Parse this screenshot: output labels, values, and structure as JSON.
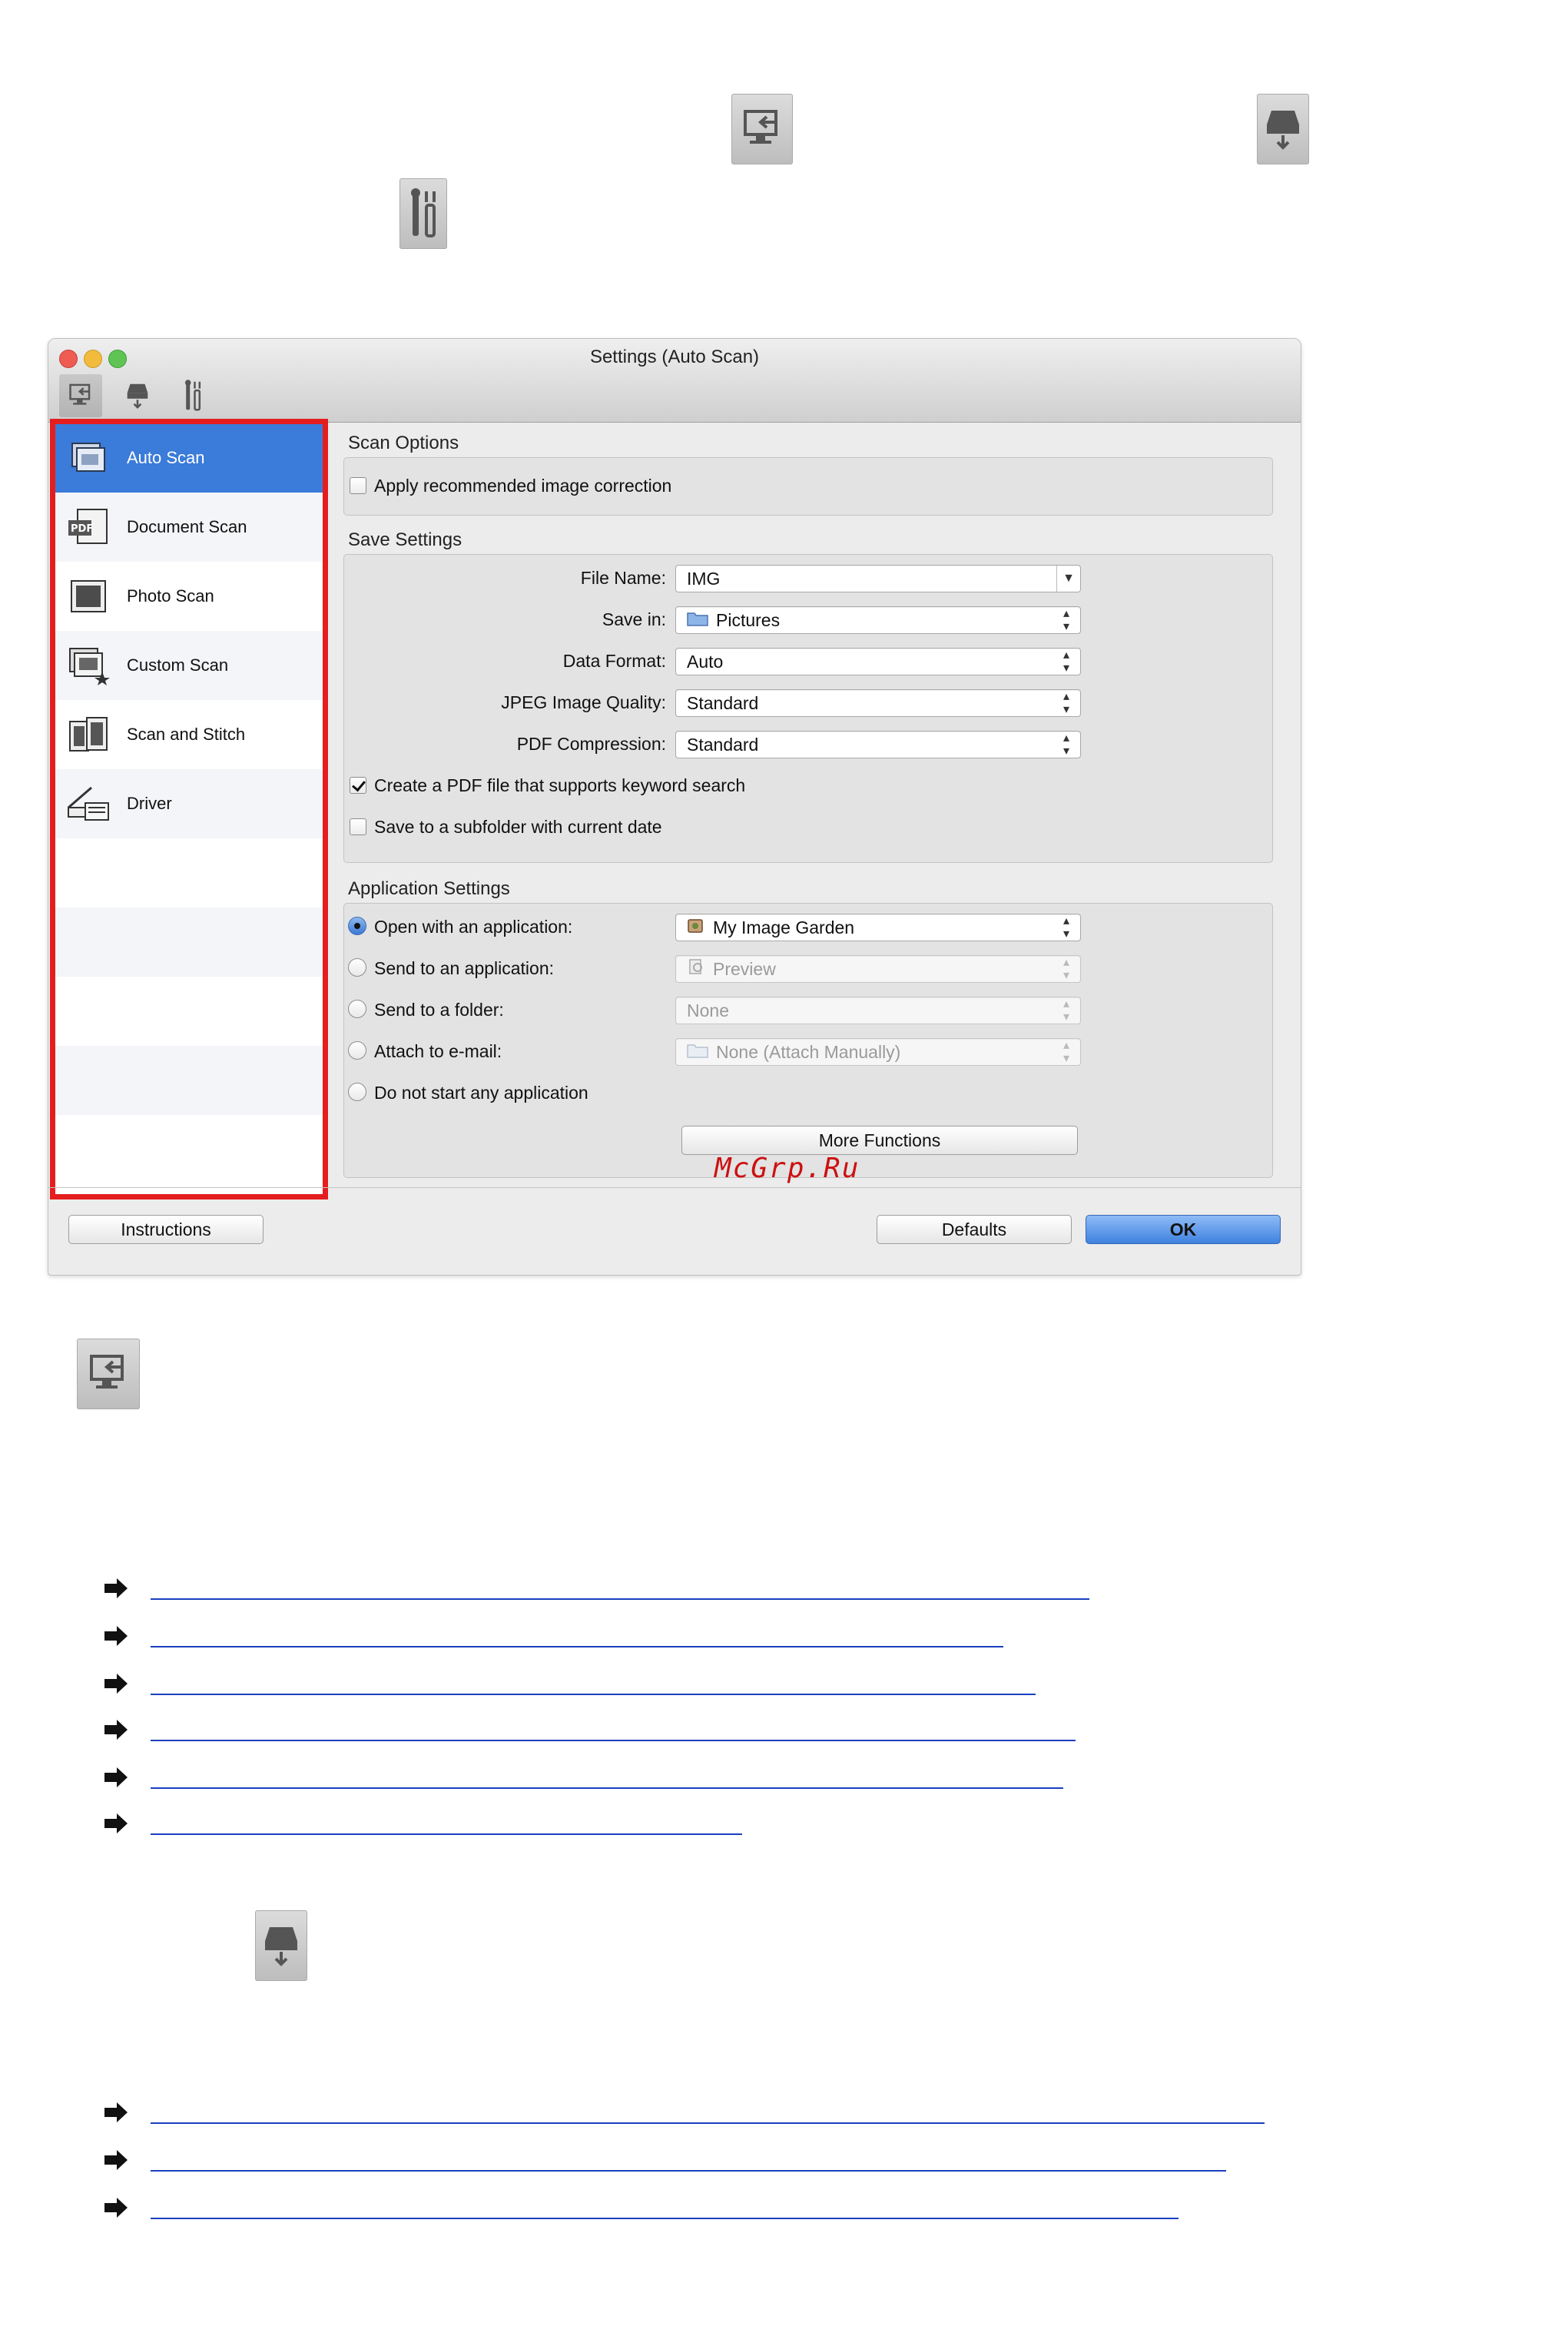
{
  "window": {
    "title": "Settings (Auto Scan)",
    "toolbar_tabs": [
      {
        "name": "scanning-from-computer-tab",
        "icon": "computer-scan-icon"
      },
      {
        "name": "scanning-from-operation-panel-tab",
        "icon": "scanner-icon"
      },
      {
        "name": "general-settings-tab",
        "icon": "tools-icon"
      }
    ]
  },
  "sidebar": {
    "items": [
      {
        "label": "Auto Scan",
        "icon": "auto-scan-icon",
        "selected": true
      },
      {
        "label": "Document Scan",
        "icon": "pdf-document-icon",
        "selected": false
      },
      {
        "label": "Photo Scan",
        "icon": "photo-icon",
        "selected": false
      },
      {
        "label": "Custom Scan",
        "icon": "custom-scan-icon",
        "selected": false
      },
      {
        "label": "Scan and Stitch",
        "icon": "stitch-icon",
        "selected": false
      },
      {
        "label": "Driver",
        "icon": "driver-icon",
        "selected": false
      }
    ]
  },
  "scan_options": {
    "title": "Scan Options",
    "apply_correction": {
      "label": "Apply recommended image correction",
      "checked": false
    }
  },
  "save_settings": {
    "title": "Save Settings",
    "file_name": {
      "label": "File Name:",
      "value": "IMG"
    },
    "save_in": {
      "label": "Save in:",
      "value": "Pictures",
      "icon": "folder-icon"
    },
    "data_format": {
      "label": "Data Format:",
      "value": "Auto"
    },
    "jpeg_quality": {
      "label": "JPEG Image Quality:",
      "value": "Standard"
    },
    "pdf_compression": {
      "label": "PDF Compression:",
      "value": "Standard"
    },
    "keyword_pdf": {
      "label": "Create a PDF file that supports keyword search",
      "checked": true
    },
    "subfolder": {
      "label": "Save to a subfolder with current date",
      "checked": false
    }
  },
  "application_settings": {
    "title": "Application Settings",
    "options": [
      {
        "label": "Open with an application:",
        "selected": true,
        "value": "My Image Garden",
        "enabled": true
      },
      {
        "label": "Send to an application:",
        "selected": false,
        "value": "Preview",
        "enabled": false
      },
      {
        "label": "Send to a folder:",
        "selected": false,
        "value": "None",
        "enabled": false
      },
      {
        "label": "Attach to e-mail:",
        "selected": false,
        "value": "None (Attach Manually)",
        "enabled": false
      },
      {
        "label": "Do not start any application",
        "selected": false
      }
    ],
    "more_functions": "More Functions"
  },
  "footer": {
    "instructions": "Instructions",
    "defaults": "Defaults",
    "ok": "OK"
  },
  "watermark": "McGrp.Ru",
  "colors": {
    "selection_blue": "#3b7bd9",
    "highlight_red": "#e41e1e",
    "link_blue": "#1a3fbf"
  }
}
